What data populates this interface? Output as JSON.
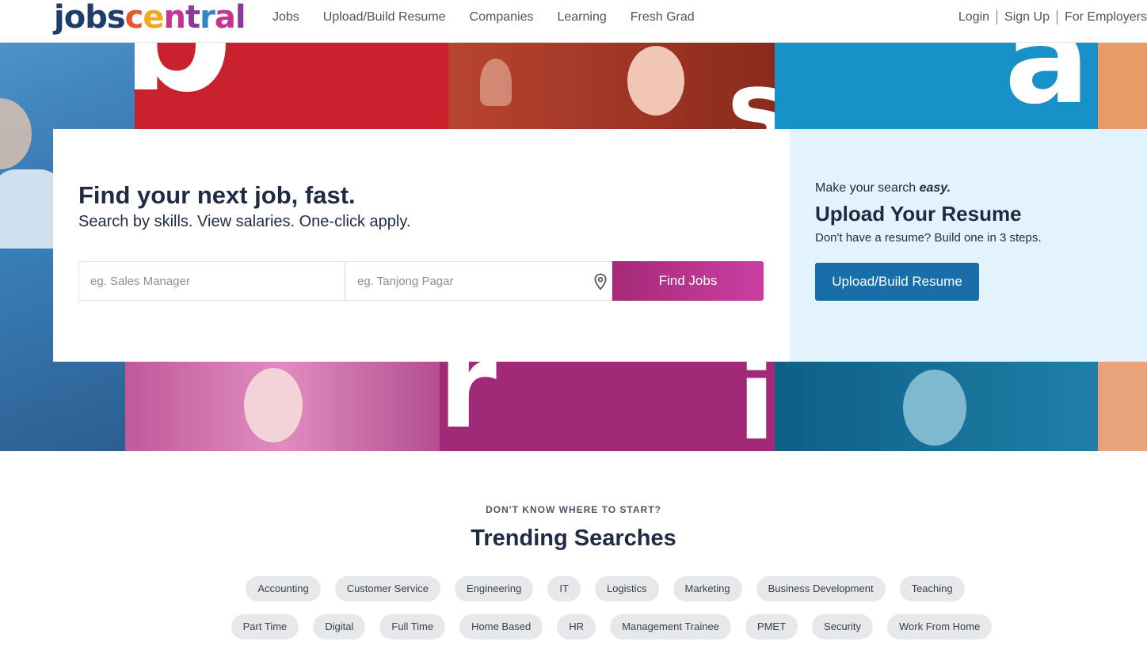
{
  "header": {
    "logo_parts": [
      {
        "text": "jobs",
        "color": "#1f3d6b"
      },
      {
        "text": "c",
        "color": "#e8562a"
      },
      {
        "text": "e",
        "color": "#f2a81d"
      },
      {
        "text": "n",
        "color": "#c7338f"
      },
      {
        "text": "t",
        "color": "#8b3a9b"
      },
      {
        "text": "r",
        "color": "#2f86c4"
      },
      {
        "text": "a",
        "color": "#c7338f"
      },
      {
        "text": "l",
        "color": "#8b3a9b"
      }
    ],
    "nav": [
      "Jobs",
      "Upload/Build Resume",
      "Companies",
      "Learning",
      "Fresh Grad"
    ],
    "auth": {
      "login": "Login",
      "signup": "Sign Up",
      "employers": "For Employers"
    }
  },
  "hero_glyphs": {
    "b": "b",
    "s": "s",
    "a": "a",
    "r": "r",
    "i": "i"
  },
  "search": {
    "title": "Find your next job, fast.",
    "subtitle": "Search by skills. View salaries. One-click apply.",
    "job_placeholder": "eg. Sales Manager",
    "location_placeholder": "eg. Tanjong Pagar",
    "button": "Find Jobs",
    "icons": {
      "location": "location-pin-icon"
    }
  },
  "resume": {
    "eyebrow_prefix": "Make your search ",
    "eyebrow_emphasis": "easy.",
    "title": "Upload Your Resume",
    "description": "Don't have a resume? Build one in 3 steps.",
    "button": "Upload/Build Resume"
  },
  "trending": {
    "eyebrow": "DON'T KNOW WHERE TO START?",
    "title": "Trending Searches",
    "row1": [
      "Accounting",
      "Customer Service",
      "Engineering",
      "IT",
      "Logistics",
      "Marketing",
      "Business Development",
      "Teaching"
    ],
    "row2": [
      "Part Time",
      "Digital",
      "Full Time",
      "Home Based",
      "HR",
      "Management Trainee",
      "PMET",
      "Security",
      "Work From Home"
    ]
  },
  "colors": {
    "accent_magenta": "#c7338f",
    "find_button": "#b5338b",
    "upload_button": "#176ea8",
    "resume_panel": "#e3f3fb",
    "chip_bg": "#e7e8ea",
    "heading": "#1f2a44"
  }
}
